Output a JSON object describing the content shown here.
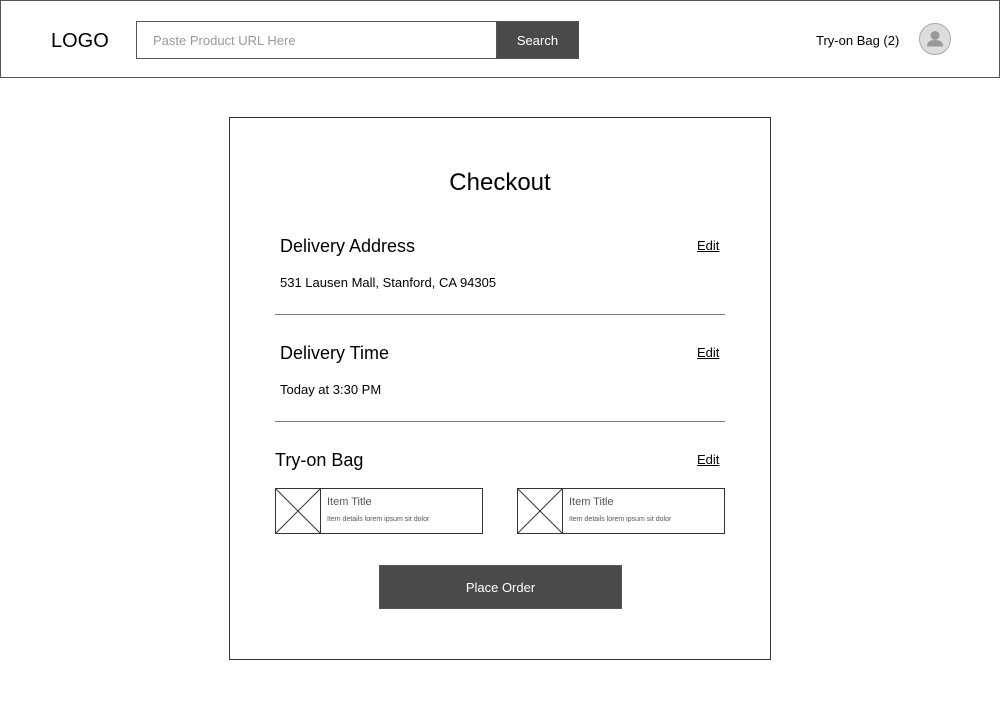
{
  "header": {
    "logo": "LOGO",
    "search_placeholder": "Paste Product URL Here",
    "search_value": "",
    "search_button": "Search",
    "bag_link": "Try-on Bag (2)",
    "avatar_icon": "user-avatar-icon"
  },
  "checkout": {
    "title": "Checkout",
    "delivery_address": {
      "heading": "Delivery Address",
      "edit": "Edit",
      "value": "531 Lausen Mall, Stanford, CA 94305"
    },
    "delivery_time": {
      "heading": "Delivery Time",
      "edit": "Edit",
      "value": "Today at 3:30 PM"
    },
    "bag": {
      "heading": "Try-on Bag",
      "edit": "Edit",
      "items": [
        {
          "title": "Item Title",
          "details": "Item details lorem ipsum sit dolor",
          "image_icon": "image-placeholder-icon"
        },
        {
          "title": "Item Title",
          "details": "Item details lorem ipsum sit dolor",
          "image_icon": "image-placeholder-icon"
        }
      ]
    },
    "place_order": "Place Order"
  },
  "colors": {
    "button_bg": "#4a4a4a",
    "button_text": "#ffffff",
    "border": "#555555",
    "avatar_bg": "#dddddd",
    "avatar_fg": "#aaaaaa"
  }
}
